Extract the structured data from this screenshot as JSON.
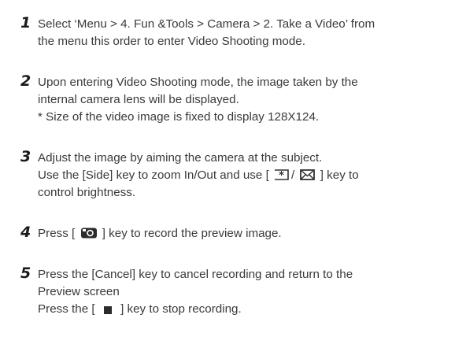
{
  "steps": [
    {
      "number": "1",
      "lines": [
        "Select ‘Menu > 4. Fun &Tools > Camera > 2. Take a Video’ from",
        "the menu this order to enter Video Shooting mode."
      ]
    },
    {
      "number": "2",
      "lines": [
        "Upon entering Video Shooting mode, the image taken by the",
        "internal camera lens will be displayed.",
        "* Size of the video image is fixed to display 128X124."
      ]
    },
    {
      "number": "3",
      "lines": [
        "Adjust the image by aiming the camera at the subject."
      ],
      "line2_a": "Use the [Side] key to zoom In/Out and use [",
      "line2_sep": "/",
      "line2_b": "] key to",
      "line3": "control brightness."
    },
    {
      "number": "4",
      "line1_a": "Press [",
      "line1_b": "] key to record the preview image."
    },
    {
      "number": "5",
      "lines": [
        "Press the [Cancel] key to cancel recording and return to the",
        "Preview screen"
      ],
      "last_a": "Press the [",
      "last_b": "] key to stop recording."
    }
  ],
  "icons": {
    "star_key": "star-key-icon",
    "message_key": "envelope-key-icon",
    "camera_key": "camera-key-icon",
    "stop_key": "stop-key-icon"
  }
}
